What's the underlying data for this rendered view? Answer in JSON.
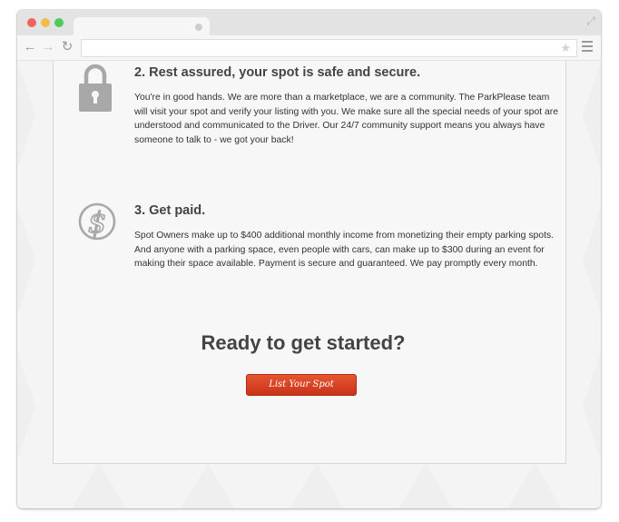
{
  "browser": {
    "tab_title": "",
    "address": "",
    "icons": {
      "back": "arrow-left-icon",
      "forward": "arrow-right-icon",
      "reload": "reload-icon",
      "bookmark": "star-icon",
      "menu": "hamburger-menu-icon",
      "expand": "expand-icon"
    }
  },
  "steps": [
    {
      "icon": "padlock-icon",
      "title": "2. Rest assured, your spot is safe and secure.",
      "text": "You're in good hands. We are more than a marketplace, we are a community. The ParkPlease team will visit your spot and verify your listing with you. We make sure all the special needs of your spot are understood and communicated to the Driver. Our 24/7 community support means you always have someone to talk to - we got your back!"
    },
    {
      "icon": "dollar-coin-icon",
      "title": "3. Get paid.",
      "text": "Spot Owners make up to $400 additional monthly income from monetizing their empty parking spots. And anyone with a parking space, even people with cars, can make up to $300 during an event for making their space available. Payment is secure and guaranteed. We pay promptly every month."
    }
  ],
  "cta": {
    "heading": "Ready to get started?",
    "button_label": "List Your Spot"
  },
  "colors": {
    "accent": "#d9421f",
    "icon_gray": "#a8a8a8",
    "text": "#333333"
  }
}
